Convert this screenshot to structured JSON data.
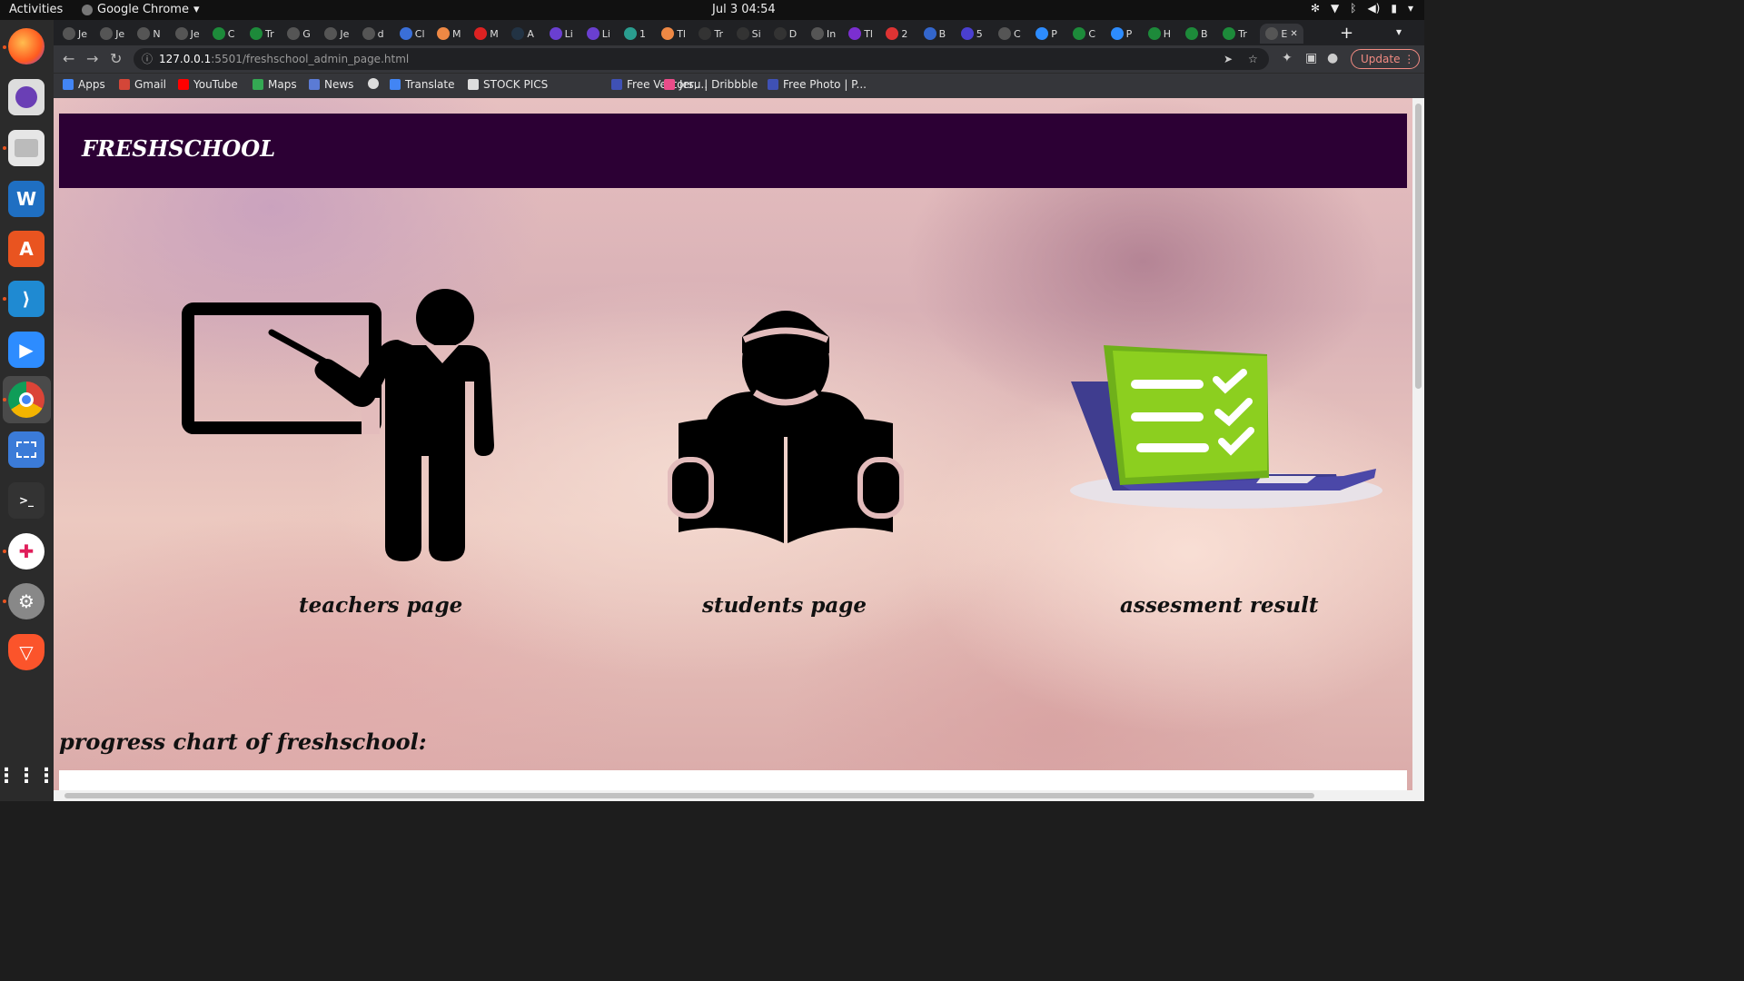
{
  "system": {
    "activities": "Activities",
    "app_name": "Google Chrome",
    "clock": "Jul 3  04:54"
  },
  "browser": {
    "tabs": [
      "Je",
      "Je",
      "N",
      "Je",
      "C",
      "Tr",
      "G",
      "Je",
      "d",
      "Cl",
      "M",
      "M",
      "A",
      "Li",
      "Li",
      "1",
      "Tl",
      "Tr",
      "Si",
      "D",
      "In",
      "Tl",
      "2",
      "B",
      "5",
      "C",
      "P",
      "C",
      "P",
      "H",
      "B",
      "Tr",
      "E"
    ],
    "url_host": "127.0.0.1",
    "url_path": ":5501/freshschool_admin_page.html",
    "update_label": "Update",
    "bookmarks": [
      "Apps",
      "Gmail",
      "YouTube",
      "Maps",
      "News",
      "",
      "Translate",
      "STOCK PICS",
      "Free Vectors,...",
      "Jeru | Dribbble",
      "Free Photo | P..."
    ]
  },
  "page": {
    "site_title": "FRESHSCHOOL",
    "cards": {
      "teachers": "teachers page",
      "students": "students page",
      "assessment": "assesment result"
    },
    "section_title": "progress chart of freshschool:"
  },
  "colors": {
    "header_bg": "#2c0034",
    "check_green": "#8ccf1f",
    "laptop_purple": "#3f3d8f"
  }
}
